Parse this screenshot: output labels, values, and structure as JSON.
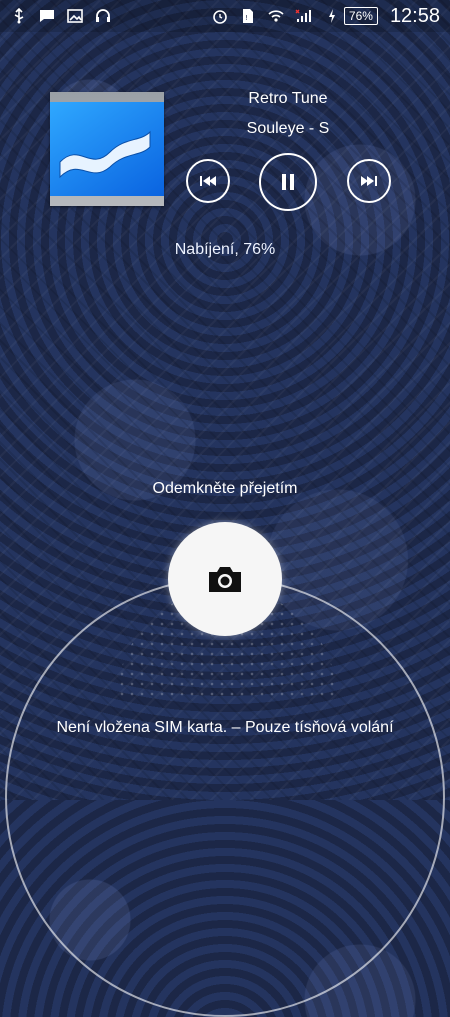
{
  "status_bar": {
    "left_icons": [
      "usb-icon",
      "message-icon",
      "image-icon",
      "headphones-icon"
    ],
    "right_icons": [
      "alarm-icon",
      "sim-icon",
      "wifi-icon",
      "signal-icon",
      "charging-icon"
    ],
    "battery_percent": "76%",
    "time": "12:58"
  },
  "music": {
    "title": "Retro Tune",
    "artist": "Souleye - S",
    "controls": [
      "previous-icon",
      "pause-icon",
      "next-icon"
    ]
  },
  "charging_text": "Nabíjení, 76%",
  "unlock_hint": "Odemkněte přejetím",
  "camera_icon": "camera-icon",
  "sim_message": "Není vložena SIM karta. – Pouze tísňová volání",
  "colors": {
    "background": "#1c2747",
    "accent": "#ffffff"
  }
}
